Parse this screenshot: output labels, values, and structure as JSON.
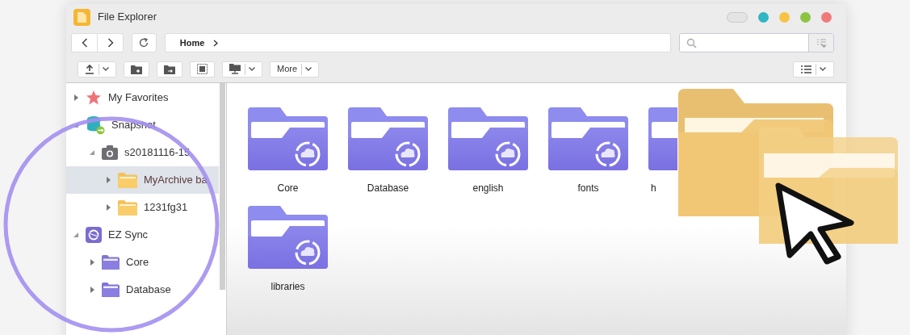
{
  "window": {
    "title": "File Explorer",
    "controls": [
      {
        "kind": "toggle",
        "on": false
      },
      {
        "kind": "dot",
        "color": "#2fb5c3"
      },
      {
        "kind": "dot",
        "color": "#f6c344"
      },
      {
        "kind": "dot",
        "color": "#8cc43f"
      },
      {
        "kind": "dot",
        "color": "#f07a7a"
      }
    ]
  },
  "navigation": {
    "breadcrumb": "Home"
  },
  "toolbar": {
    "buttons": [
      {
        "kind": "upload",
        "dropdown": true
      },
      {
        "kind": "new-folder",
        "dropdown": false
      },
      {
        "kind": "move-folder",
        "dropdown": false
      },
      {
        "kind": "select-all",
        "dropdown": false
      },
      {
        "kind": "monitor",
        "dropdown": true
      },
      {
        "kind": "text",
        "label": "More",
        "dropdown": true
      }
    ],
    "view_button": {
      "dropdown": true
    }
  },
  "sidebar": {
    "tree": [
      {
        "label": "My Favorites",
        "kind": "star",
        "expanded": false,
        "selected": false
      },
      {
        "label": "Snapshot",
        "kind": "snapshot",
        "expanded": true,
        "selected": false,
        "children": [
          {
            "label": "s20181116-15",
            "kind": "camera",
            "expanded": true,
            "selected": false,
            "children": [
              {
                "label": "MyArchive ba",
                "kind": "folder",
                "expanded": false,
                "selected": true
              },
              {
                "label": "1231fg31",
                "kind": "folder",
                "expanded": false,
                "selected": false
              }
            ]
          }
        ]
      },
      {
        "label": "EZ Sync",
        "kind": "sync",
        "expanded": true,
        "selected": false,
        "children": [
          {
            "label": "Core",
            "kind": "sync-folder",
            "expanded": false,
            "selected": false
          },
          {
            "label": "Database",
            "kind": "sync-folder",
            "expanded": false,
            "selected": false
          }
        ]
      }
    ]
  },
  "content": {
    "folders": [
      {
        "name": "Core"
      },
      {
        "name": "Database"
      },
      {
        "name": "english"
      },
      {
        "name": "fonts"
      },
      {
        "name": "h",
        "clipped": true
      },
      {
        "name": "libraries"
      }
    ]
  }
}
